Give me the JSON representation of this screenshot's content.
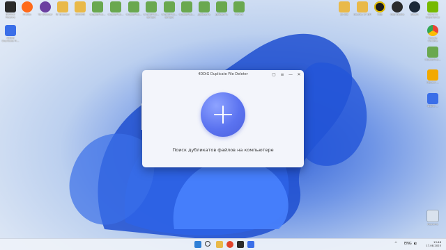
{
  "desktop": {
    "top_icons": [
      {
        "label": "DaVinci Resolve",
        "color": "#2a2a2a"
      },
      {
        "label": "Firefox",
        "color": "#ff6a1a"
      },
      {
        "label": "Tor Browser",
        "color": "#6b3fa0"
      },
      {
        "label": "Nr Browser",
        "color": "#e9b949"
      },
      {
        "label": "WinRAR",
        "color": "#e9b949"
      },
      {
        "label": "CryptoPlus...",
        "color": "#6aa84f"
      },
      {
        "label": "CryptoPlus...",
        "color": "#6aa84f"
      },
      {
        "label": "CryptoPlus...",
        "color": "#6aa84f"
      },
      {
        "label": "CryptoPlus... вопрос",
        "color": "#6aa84f"
      },
      {
        "label": "CryptoPlus... вопрос",
        "color": "#6aa84f"
      },
      {
        "label": "CryptoPlus...",
        "color": "#6aa84f"
      },
      {
        "label": "Добавить",
        "color": "#6aa84f"
      },
      {
        "label": "Добавить",
        "color": "#6aa84f"
      },
      {
        "label": "Метки",
        "color": "#6aa84f"
      }
    ],
    "right_top_icons": [
      {
        "label": "sk-kits",
        "color": "#e9b949"
      },
      {
        "label": "Ubuntu 17 ВМ",
        "color": "#e9b949"
      },
      {
        "label": "OBS",
        "color": "#1c1c1c"
      },
      {
        "label": "OBS Studio",
        "color": "#2b2b2b"
      },
      {
        "label": "Steam",
        "color": "#1b2838"
      },
      {
        "label": "GeForce Experience",
        "color": "#76b900"
      }
    ],
    "left_icon": {
      "label": "4DDiG Duplicate Fi...",
      "color": "#3a6ee8"
    },
    "right_column": [
      {
        "label": "Google Chrome",
        "color": "#ffffff"
      },
      {
        "label": "CryptoPlus...",
        "color": "#6aa84f"
      },
      {
        "label": "Movavi ...",
        "color": "#f2a900"
      },
      {
        "label": "4DDiG ...",
        "color": "#3a6ee8"
      }
    ],
    "recycle_bin": {
      "label": "Корзина"
    }
  },
  "window": {
    "title": "4DDiG Duplicate File Deleter",
    "caption": "Поиск дубликатов файлов на компьютере",
    "controls": {
      "minimize": "—",
      "close": "✕"
    }
  },
  "taskbar": {
    "tray_lang": "ENG",
    "time": "13:48",
    "date": "17.08.2023"
  }
}
